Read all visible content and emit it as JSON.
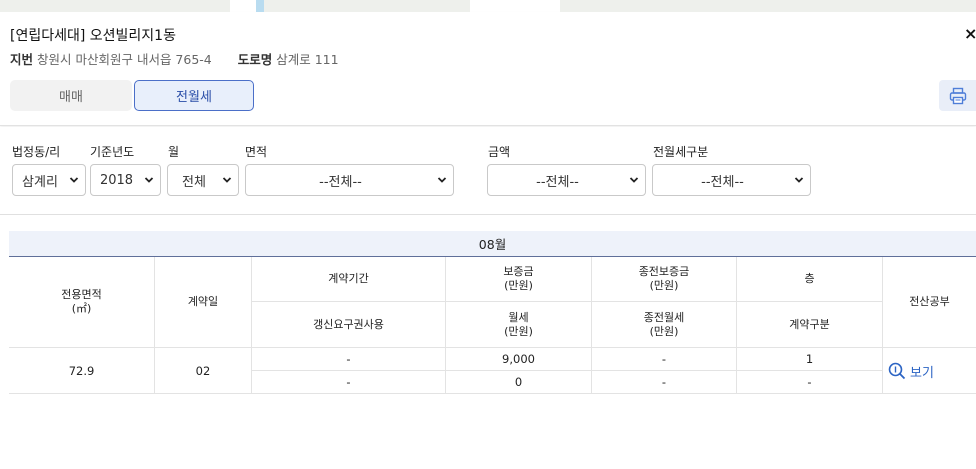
{
  "header": {
    "title": "[연립다세대] 오션빌리지1동",
    "close_label": "×",
    "jibun_label": "지번",
    "jibun_value": "창원시 마산회원구 내서읍 765-4",
    "road_label": "도로명",
    "road_value": "삼계로 111",
    "tabs": [
      {
        "label": "매매",
        "active": false
      },
      {
        "label": "전월세",
        "active": true
      }
    ],
    "print_icon": "printer-icon"
  },
  "filters": {
    "dong": {
      "label": "법정동/리",
      "value": "삼계리"
    },
    "year": {
      "label": "기준년도",
      "value": "2018"
    },
    "month": {
      "label": "월",
      "value": "전체"
    },
    "area": {
      "label": "면적",
      "value": "--전체--"
    },
    "amount": {
      "label": "금액",
      "value": "--전체--"
    },
    "rent_type": {
      "label": "전월세구분",
      "value": "--전체--"
    }
  },
  "table": {
    "month": "08월",
    "headers": {
      "area": "전용면적\n(㎡)",
      "contract_day": "계약일",
      "period": "계약기간",
      "renewal": "갱신요구권사용",
      "deposit": "보증금\n(만원)",
      "monthly": "월세\n(만원)",
      "prev_deposit": "종전보증금\n(만원)",
      "prev_monthly": "종전월세\n(만원)",
      "floor": "층",
      "contract_type": "계약구분",
      "registry": "전산공부"
    },
    "rows": [
      {
        "area": "72.9",
        "contract_day": "02",
        "period": "-",
        "renewal": "-",
        "deposit": "9,000",
        "monthly": "0",
        "prev_deposit": "-",
        "prev_monthly": "-",
        "floor": "1",
        "contract_type": "-",
        "view_label": "보기"
      }
    ]
  },
  "colors": {
    "accent": "#2c64c4",
    "tab_active_border": "#4b6fc8",
    "month_bar_bg": "#eef2fa"
  }
}
